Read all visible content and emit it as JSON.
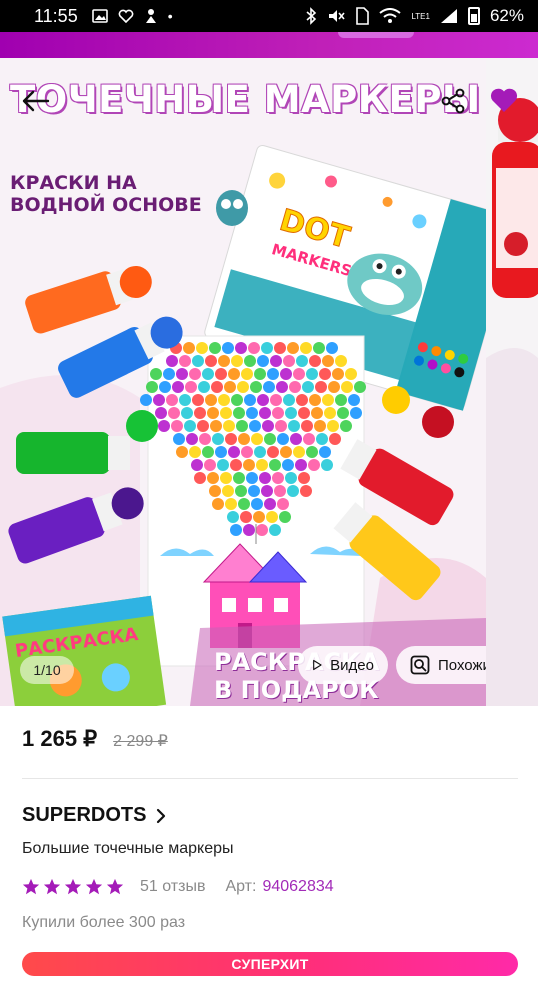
{
  "status_bar": {
    "time": "11:55",
    "battery": "62%",
    "network": "LTE1"
  },
  "gallery": {
    "headline": "ТОЧЕЧНЫЕ МАРКЕРЫ",
    "subheadline": "КРАСКИ НА ВОДНОЙ ОСНОВЕ",
    "promo": "РАСКРАСКА В ПОДАРОК",
    "counter": "1/10",
    "video_label": "Видео",
    "similar_label": "Похожие"
  },
  "product": {
    "price": "1 265 ₽",
    "old_price": "2 299 ₽",
    "brand": "SUPERDOTS",
    "name": "Большие точечные маркеры",
    "rating": 5,
    "reviews": "51 отзыв",
    "art_label": "Арт:",
    "art_value": "94062834",
    "bought": "Купили более 300 раз",
    "badge": "СУПЕРХИТ"
  },
  "colors": {
    "accent": "#a22ab8",
    "star": "#a41bb8",
    "badge_start": "#ff4a4a",
    "badge_end": "#ff2aa8",
    "header": "#b010b8"
  },
  "icons": {
    "back": "arrow-left-icon",
    "share": "share-icon",
    "favorite": "heart-icon",
    "video": "play-icon",
    "similar": "search-similar-icon"
  }
}
